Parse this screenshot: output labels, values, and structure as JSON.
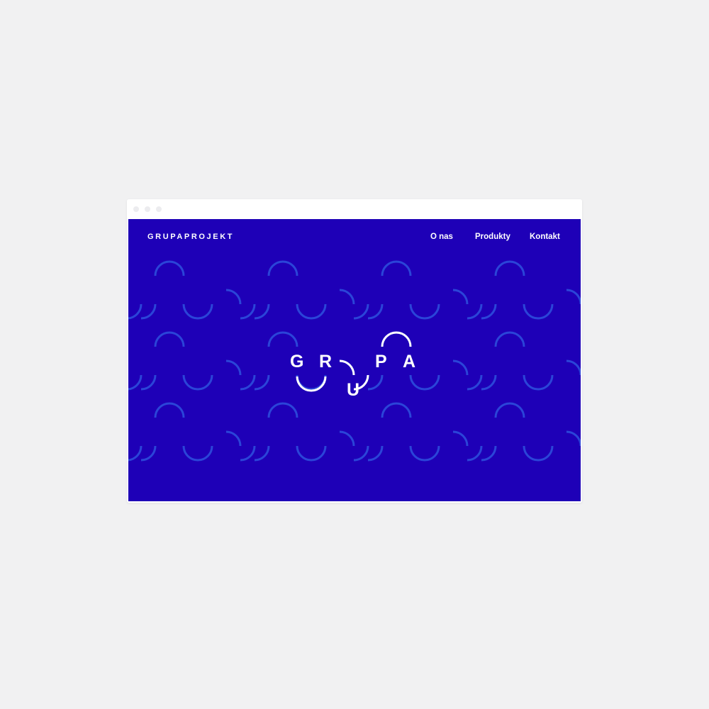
{
  "colors": {
    "page_background": "#f1f1f2",
    "brand_blue": "#1e00b7",
    "pattern_arc": "#2b45d8",
    "foreground": "#ffffff",
    "window_dots": "#ececef"
  },
  "header": {
    "logo": "GRUPAPROJEKT",
    "nav": [
      "O nas",
      "Produkty",
      "Kontakt"
    ]
  },
  "hero": {
    "letters": [
      "G",
      "R",
      "U",
      "P",
      "A"
    ]
  },
  "icons": {
    "window_controls": [
      "window-dot-icon",
      "window-dot-icon",
      "window-dot-icon"
    ],
    "background_pattern": "arc-pattern-icon"
  }
}
